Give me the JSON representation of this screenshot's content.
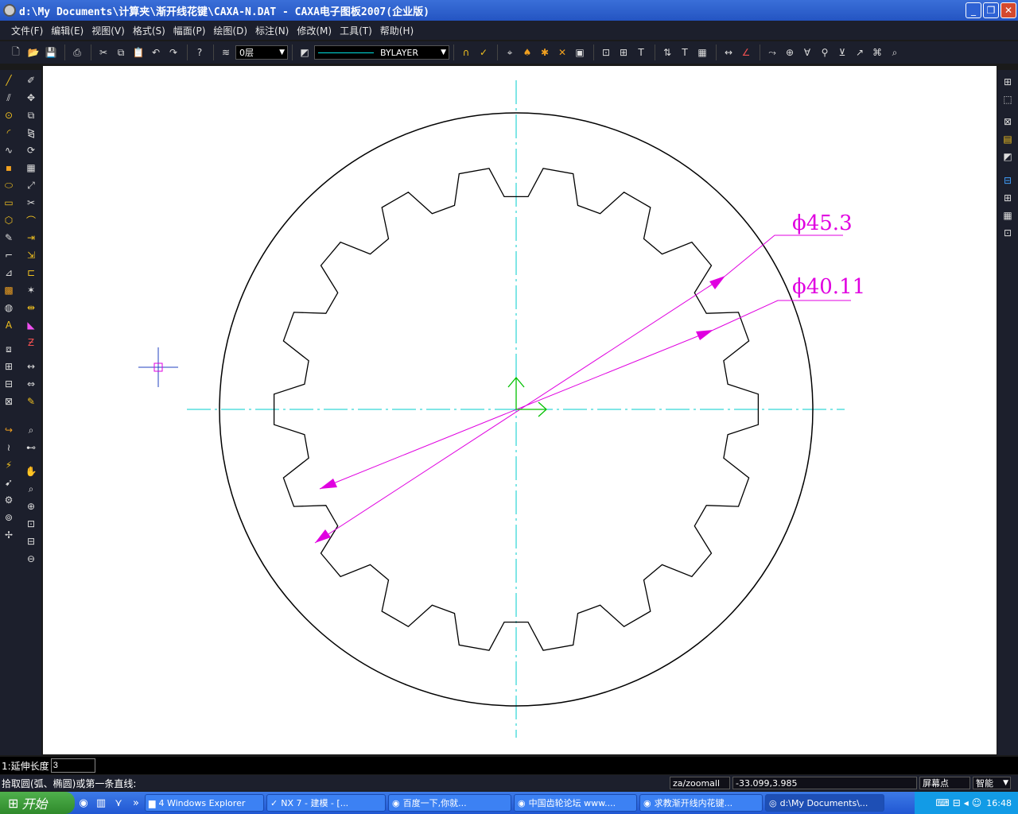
{
  "window": {
    "title": "d:\\My Documents\\计算夹\\渐开线花键\\CAXA-N.DAT - CAXA电子图板2007(企业版)",
    "buttons": {
      "minimize": "_",
      "maximize": "❐",
      "close": "✕"
    }
  },
  "menu": {
    "items": [
      "文件(F)",
      "编辑(E)",
      "视图(V)",
      "格式(S)",
      "幅面(P)",
      "绘图(D)",
      "标注(N)",
      "修改(M)",
      "工具(T)",
      "帮助(H)"
    ]
  },
  "toolbar": {
    "layer_value": "0层",
    "linetype_value": "BYLAYER"
  },
  "drawing": {
    "dim_outer": "ϕ45.3",
    "dim_inner": "ϕ40.11",
    "colors": {
      "center_line": "#00cccc",
      "dimension": "#e000e0",
      "geometry": "#000000",
      "axis": "#00c000"
    }
  },
  "command": {
    "label": "1:延伸长度",
    "value": "3",
    "prompt": "拾取圆(弧、椭圆)或第一条直线:",
    "last_command": "za/zoomall",
    "coordinates": "-33.099,3.985",
    "snap_mode": "屏幕点",
    "smart_mode": "智能"
  },
  "taskbar": {
    "start_label": "开始",
    "tasks": [
      {
        "label": "4 Windows Explorer",
        "active": false
      },
      {
        "label": "NX 7 - 建模 - [...",
        "active": false
      },
      {
        "label": "百度一下,你就...",
        "active": false
      },
      {
        "label": "中国齿轮论坛 www....",
        "active": false
      },
      {
        "label": "求教渐开线内花键...",
        "active": false
      },
      {
        "label": "d:\\My Documents\\...",
        "active": true
      }
    ],
    "clock": "16:48"
  }
}
